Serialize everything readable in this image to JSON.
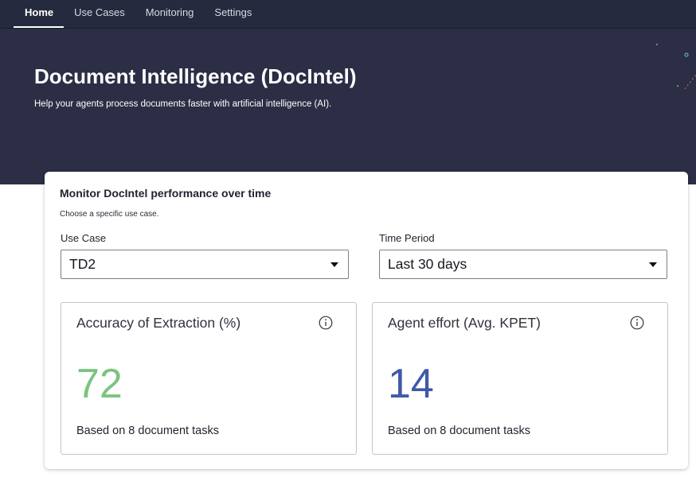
{
  "nav": {
    "items": [
      {
        "label": "Home",
        "active": true
      },
      {
        "label": "Use Cases",
        "active": false
      },
      {
        "label": "Monitoring",
        "active": false
      },
      {
        "label": "Settings",
        "active": false
      }
    ]
  },
  "hero": {
    "title": "Document Intelligence (DocIntel)",
    "subtitle": "Help your agents process documents faster with artificial intelligence (AI)."
  },
  "monitor": {
    "title": "Monitor DocIntel performance over time",
    "description": "Choose a specific use case.",
    "use_case": {
      "label": "Use Case",
      "value": "TD2"
    },
    "time_period": {
      "label": "Time Period",
      "value": "Last 30 days"
    }
  },
  "metrics": {
    "accuracy": {
      "title": "Accuracy of Extraction (%)",
      "value": "72",
      "note": "Based on 8 document tasks",
      "color": "#7cc47f",
      "icon": "info-icon"
    },
    "effort": {
      "title": "Agent effort (Avg. KPET)",
      "value": "14",
      "note": "Based on 8 document tasks",
      "color": "#3f5aa6",
      "icon": "info-icon"
    }
  },
  "colors": {
    "nav_bg": "#262a3f",
    "hero_bg": "#2b2e45"
  }
}
